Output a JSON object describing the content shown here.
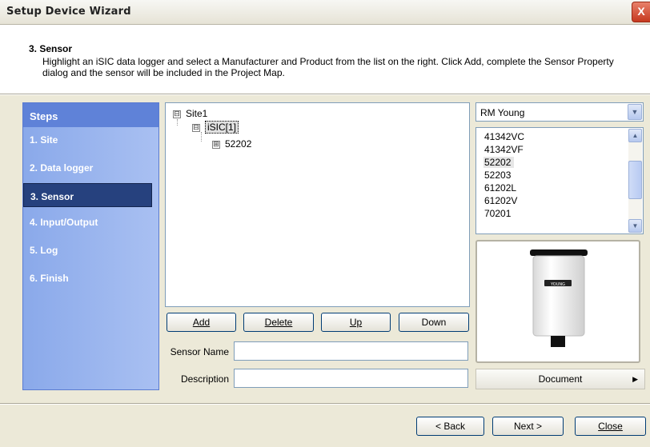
{
  "window": {
    "title": "Setup Device Wizard",
    "close_glyph": "X"
  },
  "header": {
    "step_title": "3. Sensor",
    "description": "Highlight an iSIC data logger and select a Manufacturer and Product from the list on the right. Click Add, complete the Sensor Property dialog and the sensor will be included in the Project Map."
  },
  "steps": {
    "heading": "Steps",
    "items": [
      {
        "label": "1. Site"
      },
      {
        "label": "2. Data logger"
      },
      {
        "label": "3. Sensor"
      },
      {
        "label": "4. Input/Output"
      },
      {
        "label": "5. Log"
      },
      {
        "label": "6. Finish"
      }
    ],
    "active_index": 2
  },
  "tree": {
    "root": {
      "label": "Site1",
      "expander": "⊟"
    },
    "logger": {
      "label": "iSIC[1]",
      "expander": "⊟"
    },
    "sensor": {
      "label": "52202",
      "expander": "⊞"
    }
  },
  "actions": {
    "add": "Add",
    "delete": "Delete",
    "up": "Up",
    "down": "Down"
  },
  "form": {
    "sensor_name_label": "Sensor Name",
    "sensor_name_value": "",
    "description_label": "Description",
    "description_value": ""
  },
  "manufacturer": {
    "selected": "RM Young"
  },
  "products": {
    "items": [
      "41342VC",
      "41342VF",
      "52202",
      "52203",
      "61202L",
      "61202V",
      "70201"
    ],
    "selected": "52202"
  },
  "product_image": {
    "brand_text": "YOUNG"
  },
  "document_button": "Document",
  "footer": {
    "back": "< Back",
    "next": "Next >",
    "close": "Close"
  },
  "icons": {
    "close": "close-icon",
    "dropdown": "chevron-down-icon",
    "scroll_up": "chevron-up-icon",
    "scroll_down": "chevron-down-icon",
    "menu_arrow": "triangle-right-icon"
  },
  "colors": {
    "steps_panel": "#8aa9ea",
    "steps_active": "#26417e",
    "dialog_bg": "#ece9d8"
  }
}
